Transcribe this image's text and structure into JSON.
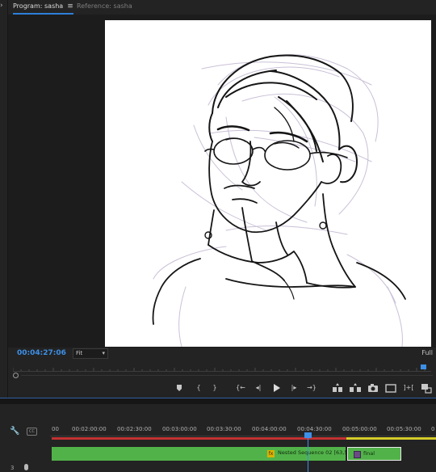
{
  "monitor": {
    "tabs": [
      {
        "label": "Program: sasha",
        "active": true
      },
      {
        "label": "Reference: sasha",
        "active": false
      }
    ],
    "tab_menu_icon": "≡",
    "timecode": "00:04:27:06",
    "zoom": "Fit",
    "quality": "Full",
    "transport_icons": [
      "add-marker",
      "mark-in",
      "mark-out",
      "go-to-in",
      "step-back",
      "play",
      "step-forward",
      "go-to-out",
      "lift",
      "extract",
      "export-frame",
      "comparison-view",
      "button-editor"
    ]
  },
  "timeline": {
    "ruler_labels": [
      "00",
      "00:02:00:00",
      "00:02:30:00",
      "00:03:00:00",
      "00:03:30:00",
      "00:04:00:00",
      "00:04:30:00",
      "00:05:00:00",
      "00:05:30:00",
      "0"
    ],
    "tracks": {
      "video": {
        "clips": [
          {
            "name": "Nested Sequence 02 [63,51%]",
            "fx_badge": "fx",
            "color": "#52b24a"
          },
          {
            "name": "final",
            "color": "#52b24a",
            "selected": true
          }
        ]
      },
      "audio": {
        "label": "3"
      }
    }
  },
  "colors": {
    "accent": "#3d90e8",
    "clip": "#52b24a",
    "render_red": "#c33131",
    "render_yellow": "#d4cc2a"
  }
}
